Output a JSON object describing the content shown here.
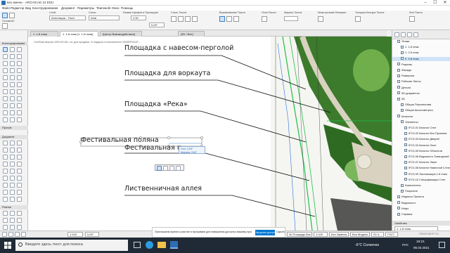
{
  "window": {
    "title": "Без имени - ARCHICAD 24 EDU",
    "controls": [
      "–",
      "☐",
      "✕"
    ]
  },
  "menu": [
    "Файл",
    "Редактор",
    "Вид",
    "Конструирование",
    "Документ",
    "Параметры",
    "Teamwork",
    "Окно",
    "Помощь"
  ],
  "infobox": {
    "main_label": "Основной:",
    "layer_label": "Слой:",
    "layer_value": "Аннотация - Текст",
    "style_label": "Стиль:",
    "style_value": "Arial",
    "size_value": "2,50",
    "angle_value": "0,00°",
    "groups": [
      "Размер Шрифта и Пропорция",
      "Стиль Текста",
      "Выравнивание Текста",
      "Поля Текста",
      "Ширина Текста",
      "Межстрочный Интервал",
      "Толщина Контура Текста",
      "Фон Текста"
    ]
  },
  "tabs": [
    {
      "label": "1. 1-й этаж"
    },
    {
      "label": "1. 1-й этаж [1. 1-й этаж]"
    },
    {
      "label": "[Центр Взаимодействия]"
    },
    {
      "label": "[3D / Все]"
    }
  ],
  "toolbox": {
    "sections": [
      "Конструирование",
      "Документ",
      "Разное"
    ],
    "mini_header": "Прочие"
  },
  "canvas": {
    "message": "Учебная версия ARCHICAD, не для продажи. В подарок пользователю SM3RP00UP..."
  },
  "labels": [
    "Площадка с навесом-перголой",
    "Площадка для воркаута",
    "Площадка «Река»",
    "Фестивальная поляна",
    "Фестивальная п",
    "Лиственничная аллея"
  ],
  "tracker": {
    "row1": "Угол: 0,00°",
    "row2": "Ширина: 2167"
  },
  "navigator": {
    "items": [
      {
        "label": "Этажи",
        "indent": 1
      },
      {
        "label": "1. 1-й этаж",
        "indent": 2
      },
      {
        "label": "1. 2-й этаж",
        "indent": 2
      },
      {
        "label": "0. 3-й этаж",
        "indent": 2,
        "selected": true
      },
      {
        "label": "Разрезы",
        "indent": 1
      },
      {
        "label": "Фасады",
        "indent": 1
      },
      {
        "label": "Развертки",
        "indent": 1
      },
      {
        "label": "Рабочие Листы",
        "indent": 1
      },
      {
        "label": "Детали",
        "indent": 1
      },
      {
        "label": "3D-документы",
        "indent": 1
      },
      {
        "label": "3D",
        "indent": 1
      },
      {
        "label": "Общая Перспектива",
        "indent": 2
      },
      {
        "label": "Общая Аксонометрия",
        "indent": 2
      },
      {
        "label": "Каталоги",
        "indent": 1
      },
      {
        "label": "Элементы",
        "indent": 2
      },
      {
        "label": "IFC3-01 Каталог Стен",
        "indent": 3
      },
      {
        "label": "IFC3-02 Каталог Все Проемов",
        "indent": 3
      },
      {
        "label": "IFC3-03 Каталог Дверей",
        "indent": 3
      },
      {
        "label": "IFC3-04 Каталог Окон",
        "indent": 3
      },
      {
        "label": "IFC3-05 Каталог Объектов",
        "indent": 3
      },
      {
        "label": "IFC3-06 Ведомость Помещений",
        "indent": 3
      },
      {
        "label": "IFC3-07 Каталог Ламп",
        "indent": 3
      },
      {
        "label": "IFC3-08 Каталог Навесной Стены",
        "indent": 3
      },
      {
        "label": "IFC3-09 Экспликация 1-й этаж",
        "indent": 3
      },
      {
        "label": "IFC3-10 Спецификация Стен",
        "indent": 3
      },
      {
        "label": "Компоненты",
        "indent": 2
      },
      {
        "label": "Покрытия",
        "indent": 2
      },
      {
        "label": "Индексы Проекта",
        "indent": 1
      },
      {
        "label": "Ведомости",
        "indent": 1
      },
      {
        "label": "Инфо",
        "indent": 1
      },
      {
        "label": "Справка",
        "indent": 1
      }
    ],
    "props_label": "Свойства",
    "props_value": "1. 1-й этаж",
    "params_label": "Параметры..."
  },
  "statusbar": {
    "zoom": "1:100",
    "angle": "0,00°",
    "popup_text": "Приглашаем принять участие в программе для повышения доступа к вашему проекту",
    "popup_button": "Загрузить доступ",
    "popup_close": "Скрыть",
    "layer_combo": "00 Площадь Все Все...",
    "scale": "1:100",
    "mode": "Без Замены",
    "model": "Вся Модель",
    "pen": "03 Ч...",
    "struct": "ГОСТ",
    "brand": "GRAPHISOFT ID"
  },
  "taskbar": {
    "search_placeholder": "Введите здесь текст для поиска",
    "weather": "-6°C Солнечно",
    "time": "19:21",
    "date": "05.03.2021",
    "lang": "РУС"
  },
  "colors": {
    "accent": "#0078d4",
    "selection": "#cfe3f7",
    "park_green": "#3c7a2c",
    "light_green": "#6fae4b",
    "path_beige": "#d9d2c0",
    "taskbar": "#1f2a36"
  }
}
